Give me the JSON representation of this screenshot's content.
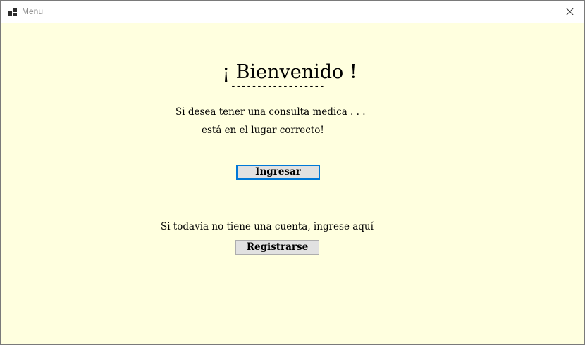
{
  "window": {
    "title": "Menu",
    "background_color": "#ffffdf",
    "icons": {
      "app": "app-icon",
      "close": "close-icon"
    }
  },
  "main": {
    "heading": "¡ Bienvenido !",
    "heading_underline": "------------------",
    "intro_line1": "Si desea tener una consulta medica . . .",
    "intro_line2": "está en el lugar correcto!",
    "login_button": "Ingresar",
    "register_prompt": "Si todavia no tiene una cuenta, ingrese aquí",
    "register_button": "Registrarse"
  }
}
